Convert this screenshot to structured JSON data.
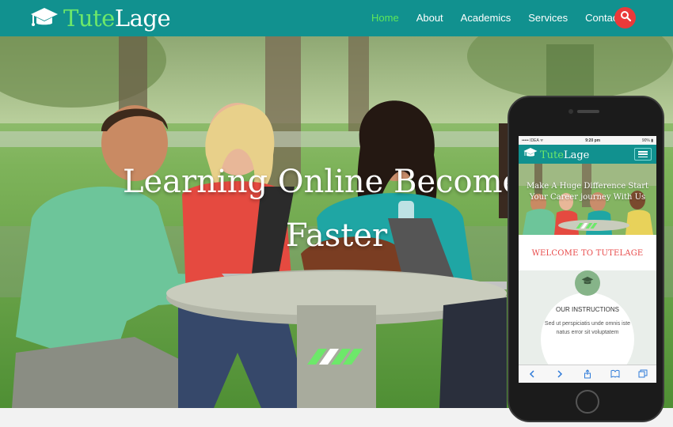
{
  "brand": {
    "part1": "Tute",
    "part2": "Lage",
    "part1_color": "#6de86a",
    "part2_color": "#ffffff",
    "icon": "graduation-cap-icon"
  },
  "nav": {
    "bg_color": "#11918f",
    "items": [
      {
        "label": "Home",
        "active": true
      },
      {
        "label": "About"
      },
      {
        "label": "Academics"
      },
      {
        "label": "Services"
      },
      {
        "label": "Contact"
      }
    ],
    "search_icon": "search-icon",
    "search_color": "#ea3a3a"
  },
  "hero": {
    "title_line1": "Learning Online Becomes Eas",
    "title_line2": "Faster",
    "slider_dots": [
      "#6de86a",
      "#ffffff",
      "#6de86a",
      "#6de86a"
    ]
  },
  "phone": {
    "status": {
      "left": "••••• IDEA ᯤ",
      "center": "9:20 pm",
      "right": "90% ▮"
    },
    "brand": {
      "part1": "Tute",
      "part2": "Lage"
    },
    "menu_icon": "hamburger-menu-icon",
    "hero_title_line1": "Make A Huge Difference Start",
    "hero_title_line2": "Your Career journey With Us",
    "welcome": "WELCOME TO TUTELAGE",
    "instructions_title": "OUR INSTRUCTIONS",
    "instructions_body": "Sed ut perspiciatis unde omnis iste natus error sit voluptatem",
    "toolbar_icons": [
      "back-icon",
      "forward-icon",
      "share-icon",
      "bookmarks-icon",
      "tabs-icon"
    ]
  }
}
